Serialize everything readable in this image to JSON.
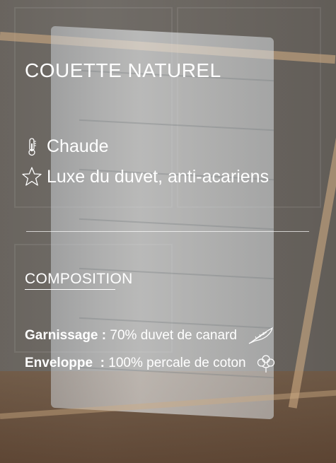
{
  "title": "COUETTE NATUREL",
  "features": [
    {
      "icon": "thermometer-icon",
      "label": "Chaude"
    },
    {
      "icon": "star-icon",
      "label": "Luxe du duvet, anti-acariens"
    }
  ],
  "composition": {
    "title": "COMPOSITION",
    "rows": [
      {
        "key": "Garnissage :",
        "value": " 70% duvet de canard",
        "icon": "feather-icon"
      },
      {
        "key": "Enveloppe  :",
        "value": " 100% percale de coton",
        "icon": "cotton-flower-icon"
      }
    ]
  }
}
